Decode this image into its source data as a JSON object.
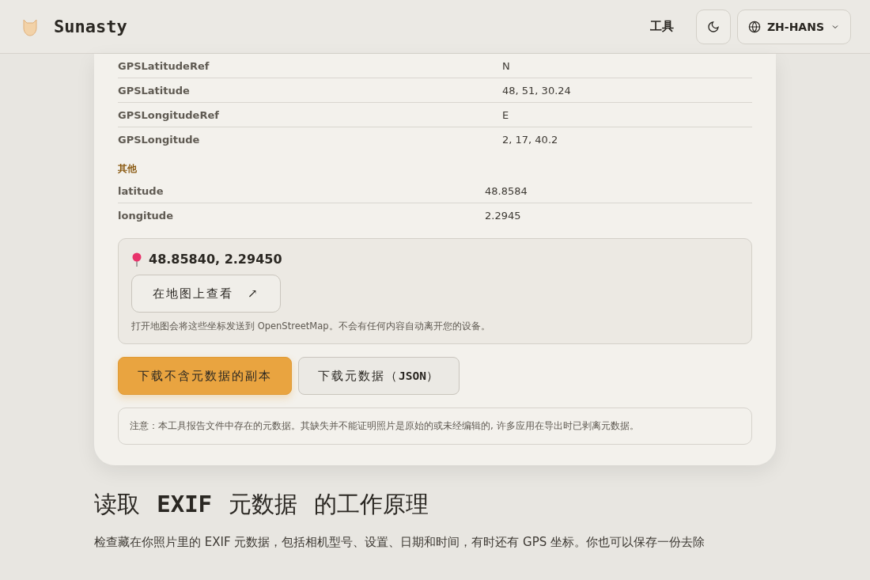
{
  "header": {
    "brand": "Sunasty",
    "nav_link": "工具",
    "language": "ZH-HANS"
  },
  "sections": [
    {
      "rows": [
        {
          "key": "GPSLatitudeRef",
          "value": "N"
        },
        {
          "key": "GPSLatitude",
          "value": "48, 51, 30.24"
        },
        {
          "key": "GPSLongitudeRef",
          "value": "E"
        },
        {
          "key": "GPSLongitude",
          "value": "2, 17, 40.2"
        }
      ]
    },
    {
      "title": "其他",
      "rows": [
        {
          "key": "latitude",
          "value": "48.8584"
        },
        {
          "key": "longitude",
          "value": "2.2945"
        }
      ]
    }
  ],
  "location": {
    "coordinates": "48.85840, 2.29450",
    "map_button": "在地图上查看",
    "map_arrow": "↗",
    "privacy_note": "打开地图会将这些坐标发送到 OpenStreetMap。不会有任何内容自动离开您的设备。"
  },
  "actions": [
    {
      "label": "下载不含元数据的副本",
      "kind": "primary"
    },
    {
      "label": "下载元数据（**JSON**）",
      "kind": "secondary"
    }
  ],
  "notice": "注意：本工具报告文件中存在的元数据。其缺失并不能证明照片是原始的或未经编辑的, 许多应用在导出时已剥离元数据。",
  "article": {
    "heading": "读取 **EXIF** 元数据 的工作原理",
    "paragraph": "检查藏在你照片里的 EXIF 元数据，包括相机型号、设置、日期和时间，有时还有 GPS 坐标。你也可以保存一份去除"
  }
}
